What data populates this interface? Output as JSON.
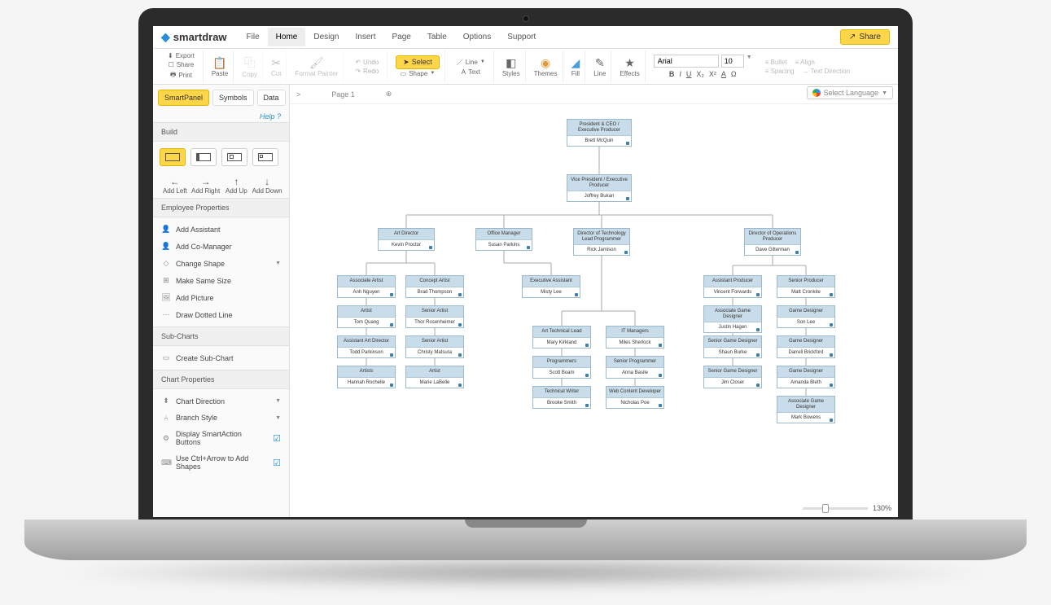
{
  "app": {
    "name": "smartdraw"
  },
  "menus": [
    "File",
    "Home",
    "Design",
    "Insert",
    "Page",
    "Table",
    "Options",
    "Support"
  ],
  "active_menu": "Home",
  "share": "Share",
  "ribbon": {
    "export": "Export",
    "print": "Print",
    "share": "Share",
    "paste": "Paste",
    "copy": "Copy",
    "cut": "Cut",
    "fp": "Format Painter",
    "undo": "Undo",
    "redo": "Redo",
    "select": "Select",
    "shape": "Shape",
    "line": "Line",
    "text": "Text",
    "styles": "Styles",
    "themes": "Themes",
    "fill": "Fill",
    "lineg": "Line",
    "effects": "Effects",
    "font": "Arial",
    "size": "10",
    "bullet": "Bullet",
    "align": "Align",
    "spacing": "Spacing",
    "textdir": "Text Direction"
  },
  "sidepanel": {
    "tabs": [
      "SmartPanel",
      "Symbols",
      "Data"
    ],
    "active": "SmartPanel",
    "help": "Help",
    "build": "Build",
    "addLeft": "Add Left",
    "addRight": "Add Right",
    "addUp": "Add Up",
    "addDown": "Add Down",
    "emp": "Employee Properties",
    "empItems": [
      "Add Assistant",
      "Add Co-Manager",
      "Change Shape",
      "Make Same Size",
      "Add Picture",
      "Draw Dotted Line"
    ],
    "sub": "Sub-Charts",
    "subItems": [
      "Create Sub-Chart"
    ],
    "chart": "Chart Properties",
    "chartItems": [
      "Chart Direction",
      "Branch Style",
      "Display SmartAction Buttons",
      "Use Ctrl+Arrow to Add Shapes"
    ]
  },
  "page": "Page 1",
  "lang": "Select Language",
  "zoom": "130%",
  "org": {
    "ceo": {
      "t": "President & CEO / Executive Producer",
      "n": "Brett McQuin"
    },
    "vp": {
      "t": "Vice President / Executive Producer",
      "n": "Joffrey Bukan"
    },
    "d1": {
      "t": "Art Director",
      "n": "Kevin Proctor"
    },
    "d2": {
      "t": "Office Manager",
      "n": "Susan Parkins"
    },
    "d3": {
      "t": "Director of Technology Lead Programmer",
      "n": "Rick Jamison"
    },
    "d4": {
      "t": "Director of Operations Producer",
      "n": "Dave Gilterman"
    },
    "ea": {
      "t": "Executive Assistant",
      "n": "Misty Lee"
    },
    "a1": [
      {
        "t": "Associate Artist",
        "n": "Anh Nguyen"
      },
      {
        "t": "Artist",
        "n": "Tom Quang"
      },
      {
        "t": "Assistant Art Director",
        "n": "Todd Parkinson"
      },
      {
        "t": "Artists",
        "n": "Hannah Rochelle"
      }
    ],
    "a2": [
      {
        "t": "Concept Artist",
        "n": "Brad Thompson"
      },
      {
        "t": "Senior Artist",
        "n": "Thor Rosenheimer"
      },
      {
        "t": "Senior Artist",
        "n": "Christy Matsura"
      },
      {
        "t": "Artist",
        "n": "Marie LaBelle"
      }
    ],
    "t1": [
      {
        "t": "Art Technical Lead",
        "n": "Mary Kirkland"
      },
      {
        "t": "Programmers",
        "n": "Scott Boam"
      },
      {
        "t": "Technical Writer",
        "n": "Brooke Smith"
      }
    ],
    "t2": [
      {
        "t": "IT Managers",
        "n": "Miles Sherlock"
      },
      {
        "t": "Senior Programmer",
        "n": "Anna Basile"
      },
      {
        "t": "Web Content Developer",
        "n": "Nicholas Poe"
      }
    ],
    "o1": [
      {
        "t": "Assistant Producer",
        "n": "Vincent Forwards"
      },
      {
        "t": "Associate Game Designer",
        "n": "Justin Hagen"
      },
      {
        "t": "Senior Game Designer",
        "n": "Shaun Burke"
      },
      {
        "t": "Senior Game Designer",
        "n": "Jim Closer"
      }
    ],
    "o2": [
      {
        "t": "Senior Producer",
        "n": "Matt Cronkite"
      },
      {
        "t": "Game Designer",
        "n": "Son Lee"
      },
      {
        "t": "Game Designer",
        "n": "Darrell Brickford"
      },
      {
        "t": "Game Designer",
        "n": "Amanda Bleth"
      },
      {
        "t": "Associate Game Designer",
        "n": "Mark Bowens"
      }
    ]
  }
}
